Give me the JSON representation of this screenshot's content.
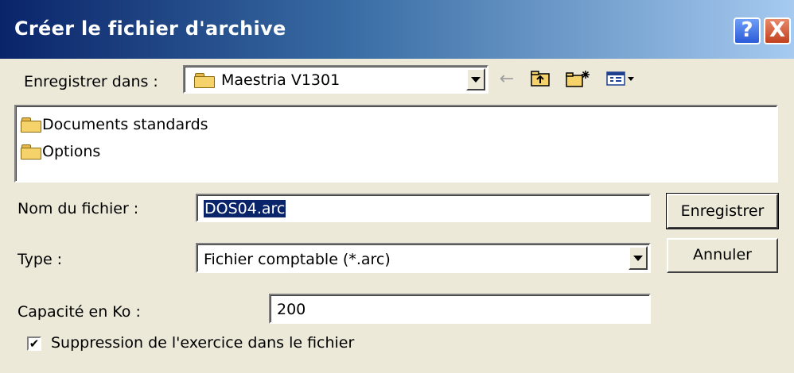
{
  "window": {
    "title": "Créer le fichier d'archive",
    "help_button": "?",
    "close_button": "X"
  },
  "save_in": {
    "label": "Enregistrer dans :",
    "value": "Maestria V1301"
  },
  "toolbar": {
    "back_icon": "←",
    "up_icon": "⮥",
    "new_folder_icon": "✱",
    "view_menu_icon": "▦▾"
  },
  "file_list": {
    "items": [
      {
        "name": "Documents standards"
      },
      {
        "name": "Options"
      }
    ]
  },
  "file_name": {
    "label": "Nom du fichier :",
    "value": "DOS04.arc"
  },
  "file_type": {
    "label": "Type :",
    "value": "Fichier comptable (*.arc)"
  },
  "capacity": {
    "label": "Capacité en Ko :",
    "value": "200"
  },
  "delete_option": {
    "label": "Suppression de l'exercice dans le fichier",
    "checked": true,
    "check_glyph": "✔"
  },
  "buttons": {
    "save": "Enregistrer",
    "cancel": "Annuler"
  }
}
